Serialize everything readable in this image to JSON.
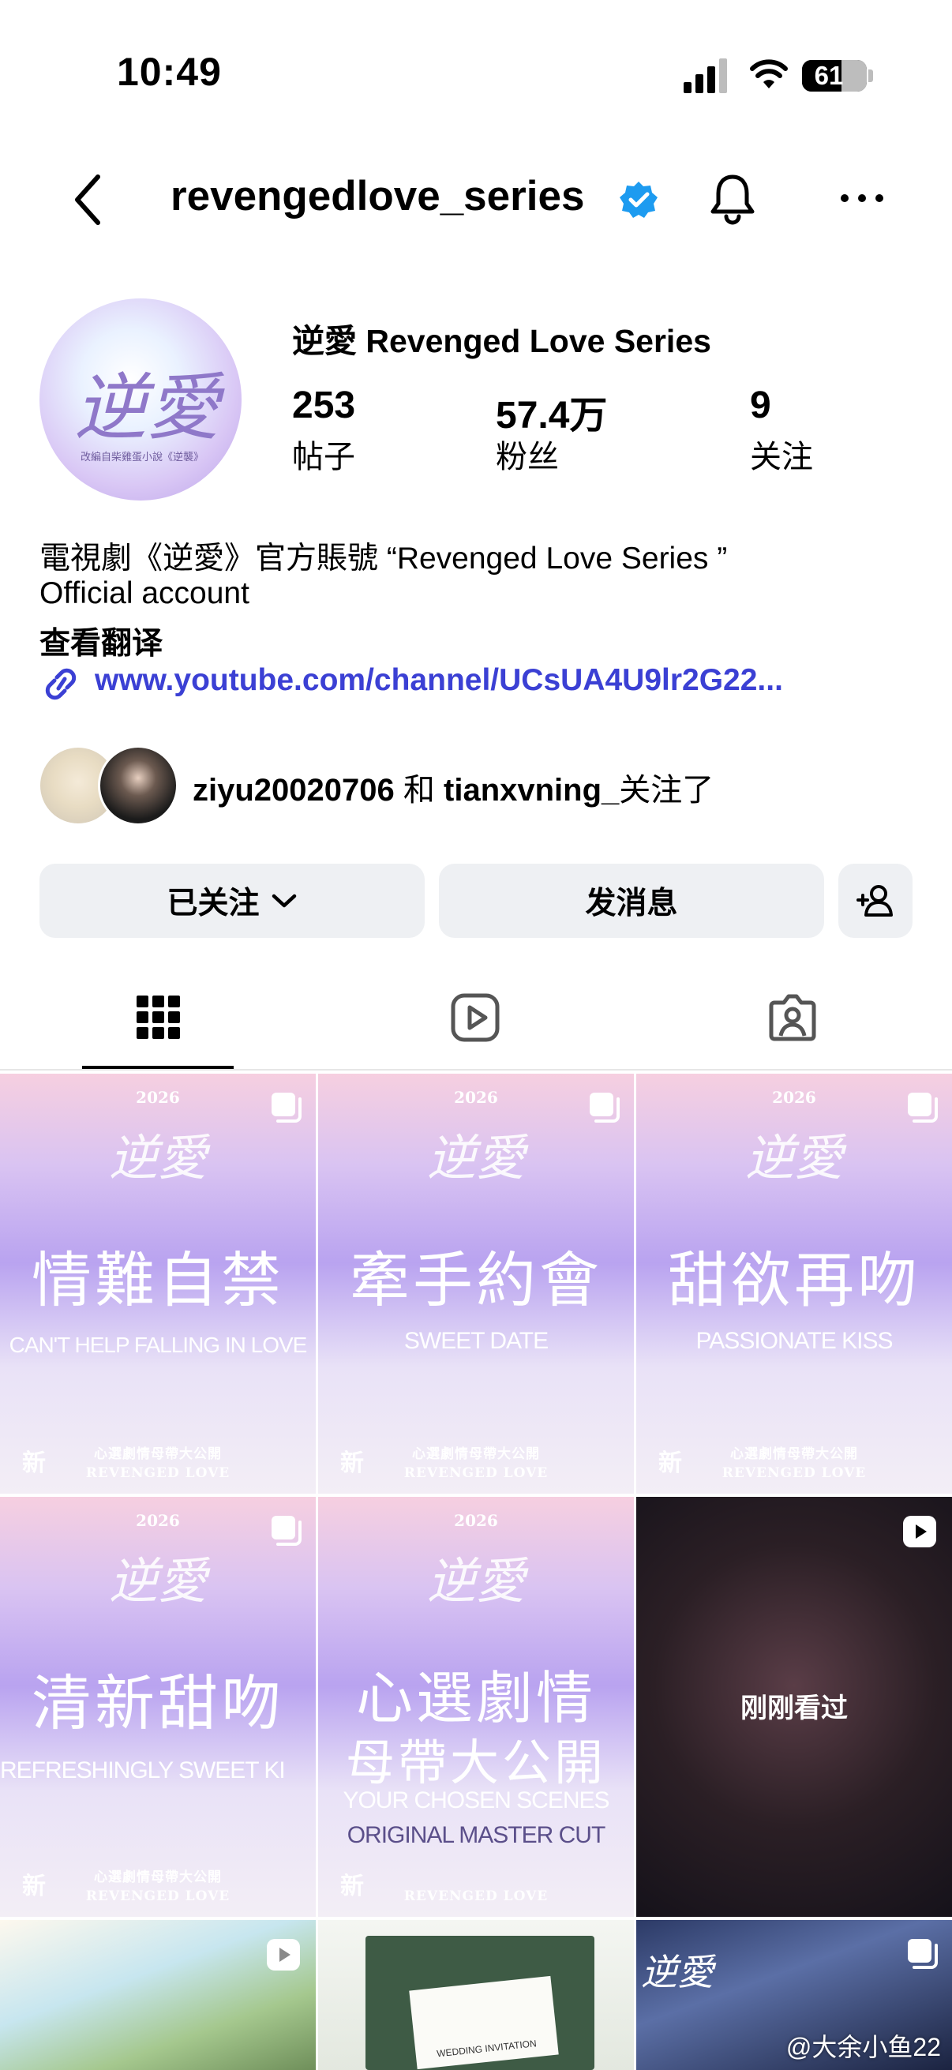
{
  "status_bar": {
    "time": "10:49",
    "battery": "61",
    "battery_level": 0.61
  },
  "header": {
    "username": "revengedlove_series",
    "verified": true
  },
  "profile": {
    "display_name": "逆愛 Revenged Love Series",
    "avatar_title": "逆愛",
    "avatar_subtitle": "改編自柴雞蛋小說《逆襲》",
    "stats": [
      {
        "value": "253",
        "label": "帖子"
      },
      {
        "value": "57.4万",
        "label": "粉丝"
      },
      {
        "value": "9",
        "label": "关注"
      }
    ],
    "bio_line1": "電視劇《逆愛》官方賬號 “Revenged Love Series ”",
    "bio_line2": "Official account",
    "translate_label": "查看翻译",
    "link": "www.youtube.com/channel/UCsUA4U9lr2G22...",
    "mutual": {
      "user1": "ziyu20020706",
      "conj": "和",
      "user2": "tianxvning_",
      "suffix": "关注了"
    }
  },
  "actions": {
    "follow_label": "已关注",
    "message_label": "发消息"
  },
  "tabs": [
    "posts-grid",
    "reels",
    "tagged"
  ],
  "grid": [
    {
      "year": "2026",
      "logo": "逆愛",
      "title_zh": "情難自禁",
      "title_en": "CAN'T HELP FALLING IN LOVE",
      "footer1": "心選劇情母帶大公開",
      "footer2": "REVENGED LOVE",
      "badge": "新"
    },
    {
      "year": "2026",
      "logo": "逆愛",
      "title_zh": "牽手約會",
      "title_en": "SWEET DATE",
      "footer1": "心選劇情母帶大公開",
      "footer2": "REVENGED LOVE",
      "badge": "新"
    },
    {
      "year": "2026",
      "logo": "逆愛",
      "title_zh": "甜欲再吻",
      "title_en": "PASSIONATE KISS",
      "footer1": "心選劇情母帶大公開",
      "footer2": "REVENGED LOVE",
      "badge": "新"
    },
    {
      "year": "2026",
      "logo": "逆愛",
      "title_zh": "清新甜吻",
      "title_en": "REFRESHINGLY SWEET KI",
      "footer1": "心選劇情母帶大公開",
      "footer2": "REVENGED LOVE",
      "badge": "新"
    },
    {
      "year": "2026",
      "logo": "逆愛",
      "title_zh": "心選劇情",
      "title_zh2": "母帶大公開",
      "title_en": "YOUR CHOSEN SCENES",
      "title_en2": "ORIGINAL MASTER CUT",
      "footer2": "REVENGED LOVE",
      "badge": "新"
    },
    {
      "overlay": "刚刚看过"
    },
    {
      "caption": ""
    },
    {
      "caption": "WEDDING INVITATION"
    },
    {
      "caption": "逆愛"
    }
  ],
  "watermark": "@大余小鱼22"
}
